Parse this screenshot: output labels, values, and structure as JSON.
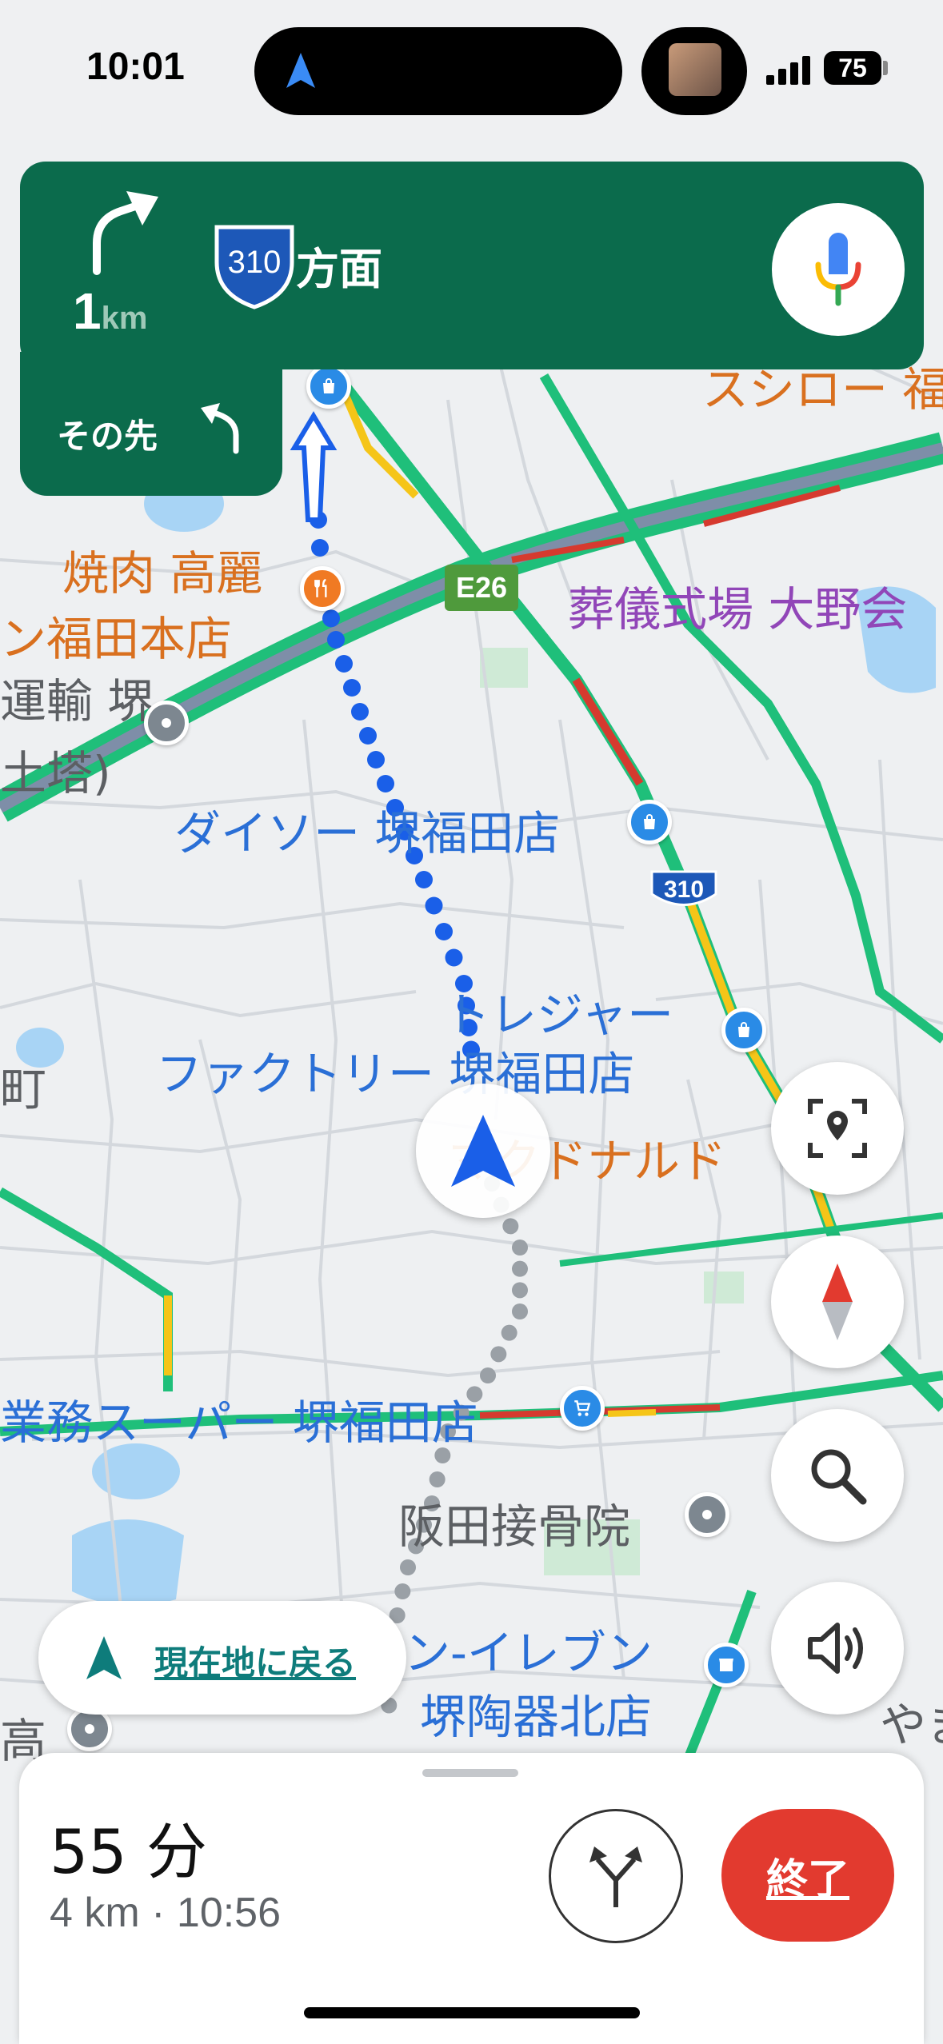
{
  "status_bar": {
    "time": "10:01",
    "battery": "75"
  },
  "nav_banner": {
    "distance_value": "1",
    "distance_unit": "km",
    "route_shield": "310",
    "direction_text": "方面",
    "then_label": "その先"
  },
  "map": {
    "labels": {
      "yakiniku": "焼肉 高麗",
      "fukuda_honten": "ン福田本店",
      "unyu_sakai": "運輸 堺",
      "doto": "土塔)",
      "funeral": "葬儀式場 大野会",
      "daiso": "ダイソー 堺福田店",
      "treasure_1": "トレジャー",
      "treasure_2": "ファクトリー 堺福田店",
      "machi": "町",
      "mcdonalds": "マクドナルド",
      "gyomu": "業務スーパー 堺福田店",
      "sakata": "阪田接骨院",
      "eleven_1": "ン-イレブン",
      "eleven_2": "堺陶器北店",
      "taka": "高",
      "yama": "やま",
      "sushiro": "スシロー 福",
      "expressway_shield": "E26",
      "route_shield": "310",
      "top_shield": "310"
    }
  },
  "controls": {
    "recenter_label": "現在地に戻る"
  },
  "trip": {
    "duration": "55 分",
    "distance_eta": "4 km · 10:56",
    "end_label": "終了"
  },
  "icons": [
    "turn-right-icon",
    "turn-left-icon",
    "mic-icon",
    "navigation-arrow-icon",
    "location-pin-icon",
    "compass-icon",
    "search-icon",
    "volume-icon",
    "alt-routes-icon",
    "shopping-bag-icon",
    "restaurant-icon",
    "cart-icon",
    "store-icon"
  ],
  "colors": {
    "banner_green": "#0b6b4c",
    "route_blue": "#1a5fe8",
    "end_red": "#e23a2f",
    "traffic_green": "#1fbf7a"
  }
}
